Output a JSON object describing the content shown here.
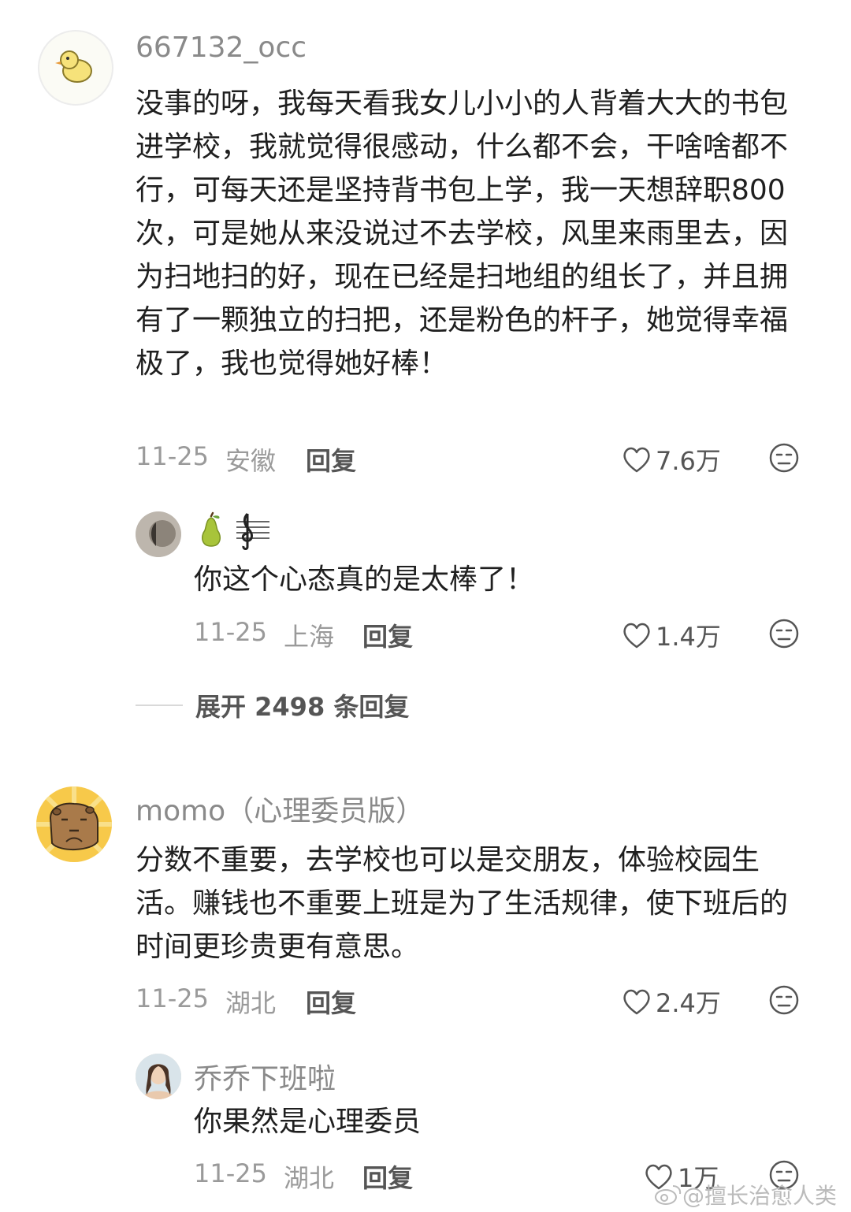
{
  "comments": [
    {
      "username": "667132_occ",
      "avatar_icon": "duck-icon",
      "text": "没事的呀，我每天看我女儿小小的人背着大大的书包进学校，我就觉得很感动，什么都不会，干啥啥都不行，可每天还是坚持背书包上学，我一天想辞职800次，可是她从来没说过不去学校，风里来雨里去，因为扫地扫的好，现在已经是扫地组的组长了，并且拥有了一颗独立的扫把，还是粉色的杆子，她觉得幸福极了，我也觉得她好棒！",
      "date": "11-25",
      "location": "安徽",
      "reply_label": "回复",
      "likes": "7.6万",
      "replies": [
        {
          "username_icons": [
            "pear-icon",
            "treble-clef-icon"
          ],
          "text": "你这个心态真的是太棒了！",
          "date": "11-25",
          "location": "上海",
          "reply_label": "回复",
          "likes": "1.4万"
        }
      ],
      "expand_label": "展开 2498 条回复"
    },
    {
      "username": "momo（心理委员版）",
      "avatar_icon": "capybara-icon",
      "text": "分数不重要，去学校也可以是交朋友，体验校园生活。赚钱也不重要上班是为了生活规律，使下班后的时间更珍贵更有意思。",
      "date": "11-25",
      "location": "湖北",
      "reply_label": "回复",
      "likes": "2.4万",
      "replies": [
        {
          "username": "乔乔下班啦",
          "text": "你果然是心理委员",
          "date": "11-25",
          "location": "湖北",
          "reply_label": "回复",
          "likes": "1万"
        }
      ]
    }
  ],
  "watermark": "@擅长治愈人类",
  "colors": {
    "username": "#8a8a8a",
    "meta": "#9a9a9a",
    "text": "#1f1f1f",
    "action": "#555555"
  }
}
